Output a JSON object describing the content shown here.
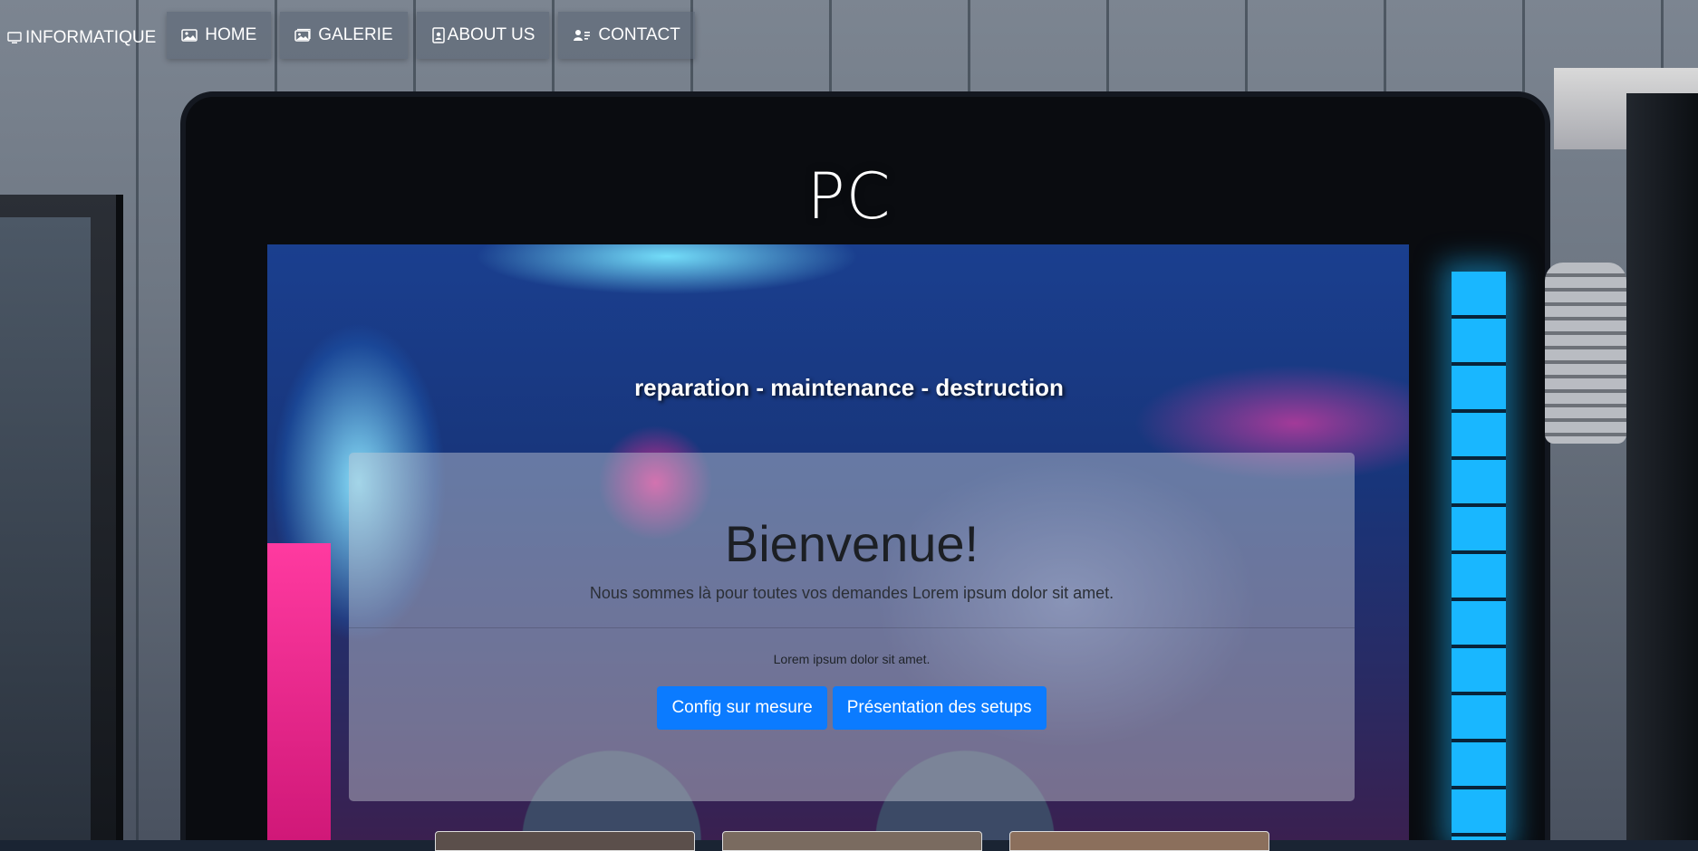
{
  "navbar": {
    "brand": "INFORMATIQUE",
    "items": [
      {
        "label": "HOME",
        "icon": "image-icon"
      },
      {
        "label": "GALERIE",
        "icon": "images-icon"
      },
      {
        "label": "ABOUT US",
        "icon": "file-person-icon"
      },
      {
        "label": "CONTACT",
        "icon": "person-lines-icon"
      }
    ]
  },
  "hero": {
    "title": "PC",
    "subtitle": "reparation - maintenance - destruction"
  },
  "jumbotron": {
    "title": "Bienvenue!",
    "lead": "Nous sommes là pour toutes vos demandes Lorem ipsum dolor sit amet.",
    "text": "Lorem ipsum dolor sit amet.",
    "buttons": [
      "Config sur mesure",
      "Présentation des setups"
    ]
  },
  "colors": {
    "primary_button": "#0b7bff",
    "nav_bg": "rgba(90,100,115,0.55)"
  }
}
